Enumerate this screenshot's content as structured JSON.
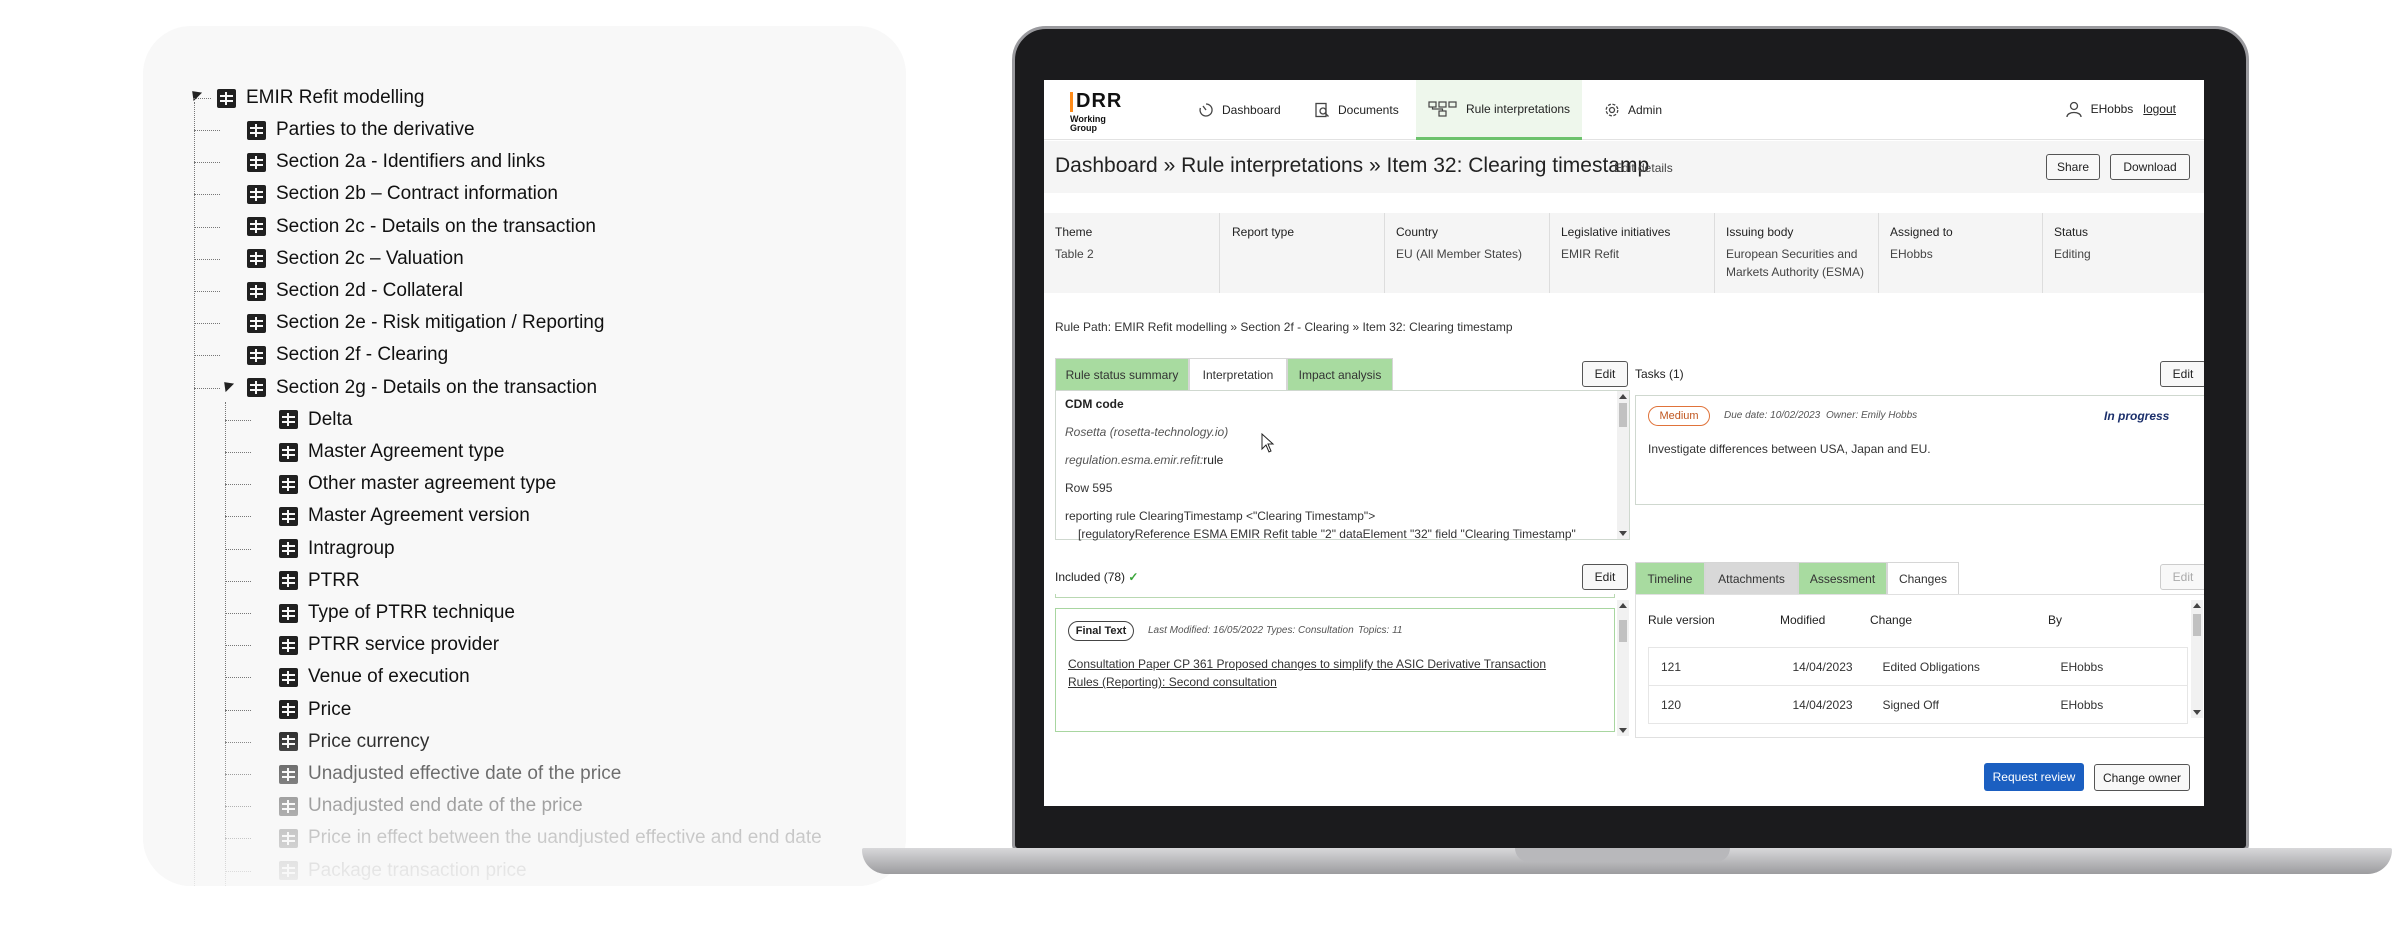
{
  "tree": {
    "root": "EMIR Refit modelling",
    "sections": [
      "Parties to the derivative",
      "Section 2a - Identifiers and links",
      "Section 2b – Contract information",
      "Section 2c - Details on the transaction",
      "Section 2c – Valuation",
      "Section 2d - Collateral",
      "Section 2e - Risk mitigation / Reporting",
      "Section 2f - Clearing",
      "Section 2g - Details on the transaction"
    ],
    "children": [
      "Delta",
      "Master Agreement type",
      "Other master agreement type",
      "Master Agreement version",
      "Intragroup",
      "PTRR",
      "Type of PTRR technique",
      "PTRR service provider",
      "Venue of execution",
      "Price",
      "Price currency",
      "Unadjusted effective date of the price",
      "Unadjusted end date of the price",
      "Price in effect between the uandjusted effective and end date",
      "Package transaction price"
    ]
  },
  "app": {
    "logo": {
      "big": "DRR",
      "line1": "Working",
      "line2": "Group"
    },
    "nav": {
      "dashboard": "Dashboard",
      "documents": "Documents",
      "rule_interpretations": "Rule interpretations",
      "admin": "Admin"
    },
    "user": {
      "name": "EHobbs",
      "logout": "logout"
    },
    "title": "Dashboard » Rule interpretations » Item 32: Clearing timestamp",
    "edit_details": "Edit details",
    "share": "Share",
    "download": "Download",
    "meta": {
      "theme_label": "Theme",
      "theme_value": "Table 2",
      "report_type_label": "Report type",
      "country_label": "Country",
      "country_value": "EU (All Member States)",
      "legislative_label": "Legislative initiatives",
      "legislative_value": "EMIR Refit",
      "issuing_label": "Issuing body",
      "issuing_line1": "European Securities and",
      "issuing_line2": "Markets Authority (ESMA)",
      "assigned_label": "Assigned to",
      "assigned_value": "EHobbs",
      "status_label": "Status",
      "status_value": "Editing"
    },
    "rule_path": "Rule Path: EMIR Refit modelling » Section 2f - Clearing » Item 32: Clearing timestamp",
    "tabs_left": {
      "rule_status_summary": "Rule status summary",
      "interpretation": "Interpretation",
      "impact_analysis": "Impact analysis"
    },
    "edit": "Edit",
    "cdm": {
      "heading": "CDM code",
      "rosetta": "Rosetta (rosetta-technology.io)",
      "ns_prefix": "regulation.esma.emir.refit:",
      "ns_suffix": "rule",
      "row": "Row 595",
      "line1": "reporting rule ClearingTimestamp <\"Clearing Timestamp\">",
      "line2": "[regulatoryReference ESMA EMIR Refit table \"2\" dataElement \"32\" field \"Clearing Timestamp\""
    },
    "tasks": {
      "title": "Tasks (1)",
      "priority": "Medium",
      "due": "Due date: 10/02/2023",
      "owner": "Owner: Emily Hobbs",
      "state": "In progress",
      "text": "Investigate differences between USA, Japan and EU."
    },
    "included": {
      "label": "Included (78)",
      "check": "✓",
      "badge": "Final Text",
      "last_modified": "Last Modified: 16/05/2022",
      "types": "Types: Consultation",
      "topics": "Topics: 11",
      "link_line1": "Consultation Paper CP 361 Proposed changes to simplify the ASIC Derivative Transaction",
      "link_line2": "Rules (Reporting): Second consultation"
    },
    "tabs_right": {
      "timeline": "Timeline",
      "attachments": "Attachments",
      "assessment": "Assessment",
      "changes": "Changes"
    },
    "changes": {
      "headers": [
        "Rule version",
        "Modified",
        "Change",
        "By"
      ],
      "rows": [
        [
          "121",
          "14/04/2023",
          "Edited Obligations",
          "EHobbs"
        ],
        [
          "120",
          "14/04/2023",
          "Signed Off",
          "EHobbs"
        ]
      ]
    },
    "request_review": "Request review",
    "change_owner": "Change owner"
  }
}
